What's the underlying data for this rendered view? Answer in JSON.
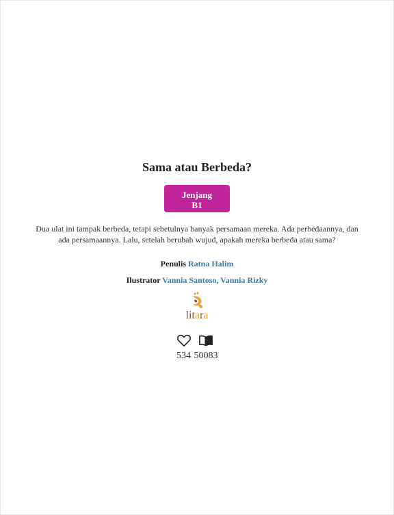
{
  "book": {
    "title": "Sama atau Berbeda?",
    "level_line1": "Jenjang",
    "level_line2": "B1",
    "description": "Dua ulat ini tampak berbeda, tetapi sebetulnya banyak persamaan mereka. Ada perbedaannya, dan ada persamaannya. Lalu, setelah berubah wujud, apakah mereka berbeda atau sama?",
    "writer_label": "Penulis",
    "writer_name": "Ratna Halim",
    "illustrator_label": "Ilustrator",
    "illustrator_names": "Vannia Santoso, Vannia Rizky",
    "publisher_logo_text": "litara"
  },
  "stats": {
    "likes": "534",
    "reads": "50083"
  },
  "icons": {
    "like": "heart-icon",
    "reads": "open-book-icon"
  },
  "colors": {
    "level_button": "#c0269a",
    "link": "#3e7aa6",
    "logo_orange": "#e8a33c",
    "logo_brown": "#8a4b2a"
  }
}
